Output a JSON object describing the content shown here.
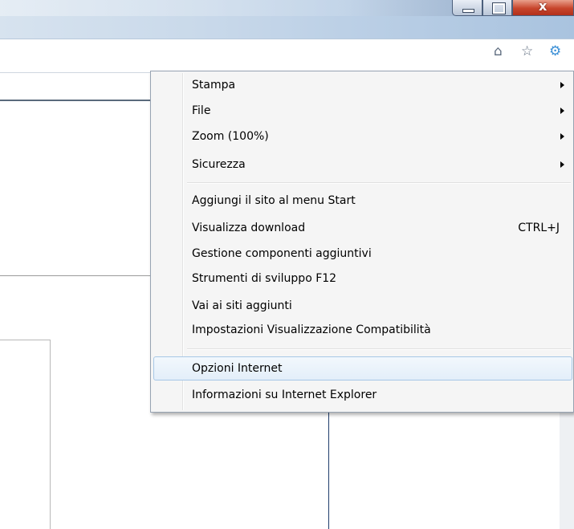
{
  "window": {
    "controls": {
      "minimize_icon": "minimize-icon",
      "maximize_icon": "maximize-icon",
      "close_label": "x"
    }
  },
  "toolbar": {
    "icons": [
      {
        "name": "home-icon",
        "glyph": "⌂"
      },
      {
        "name": "star-favorites-icon",
        "glyph": "☆"
      },
      {
        "name": "gear-icon",
        "glyph": "⚙",
        "color": "#3a8fd6"
      }
    ]
  },
  "tools_menu": {
    "groups": [
      [
        {
          "label": "Stampa",
          "submenu": true
        },
        {
          "label": "File",
          "submenu": true
        },
        {
          "label": "Zoom (100%)",
          "submenu": true
        },
        {
          "label": "Sicurezza",
          "submenu": true
        }
      ],
      [
        {
          "label": "Aggiungi il sito al menu Start"
        },
        {
          "label": "Visualizza download",
          "shortcut": "CTRL+J"
        },
        {
          "label": "Gestione componenti aggiuntivi"
        },
        {
          "label": "Strumenti di sviluppo F12"
        },
        {
          "label": "Vai ai siti aggiunti"
        },
        {
          "label": "Impostazioni Visualizzazione Compatibilità"
        }
      ],
      [
        {
          "label": "Opzioni Internet",
          "highlighted": true
        },
        {
          "label": "Informazioni su Internet Explorer"
        }
      ]
    ]
  },
  "colors": {
    "highlight_border": "#a7c7e6",
    "menu_bg": "#f5f5f5",
    "content_line": "#1f3d6b"
  }
}
